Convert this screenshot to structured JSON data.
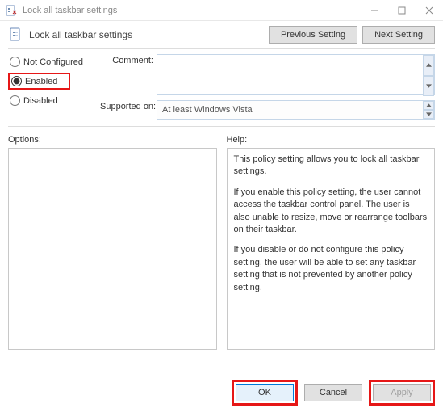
{
  "titlebar": {
    "title": "Lock all taskbar settings"
  },
  "header": {
    "title": "Lock all taskbar settings",
    "prev": "Previous Setting",
    "next": "Next Setting"
  },
  "radios": {
    "not_configured": "Not Configured",
    "enabled": "Enabled",
    "disabled": "Disabled"
  },
  "labels": {
    "comment": "Comment:",
    "supported_on": "Supported on:",
    "options": "Options:",
    "help": "Help:"
  },
  "supported_on_value": "At least Windows Vista",
  "help_text": {
    "p1": "This policy setting allows you to lock all taskbar settings.",
    "p2": "If you enable this policy setting, the user cannot access the taskbar control panel. The user is also unable to resize, move or rearrange toolbars on their taskbar.",
    "p3": "If you disable or do not configure this policy setting, the user will be able to set any taskbar setting that is not prevented by another policy setting."
  },
  "footer": {
    "ok": "OK",
    "cancel": "Cancel",
    "apply": "Apply"
  }
}
